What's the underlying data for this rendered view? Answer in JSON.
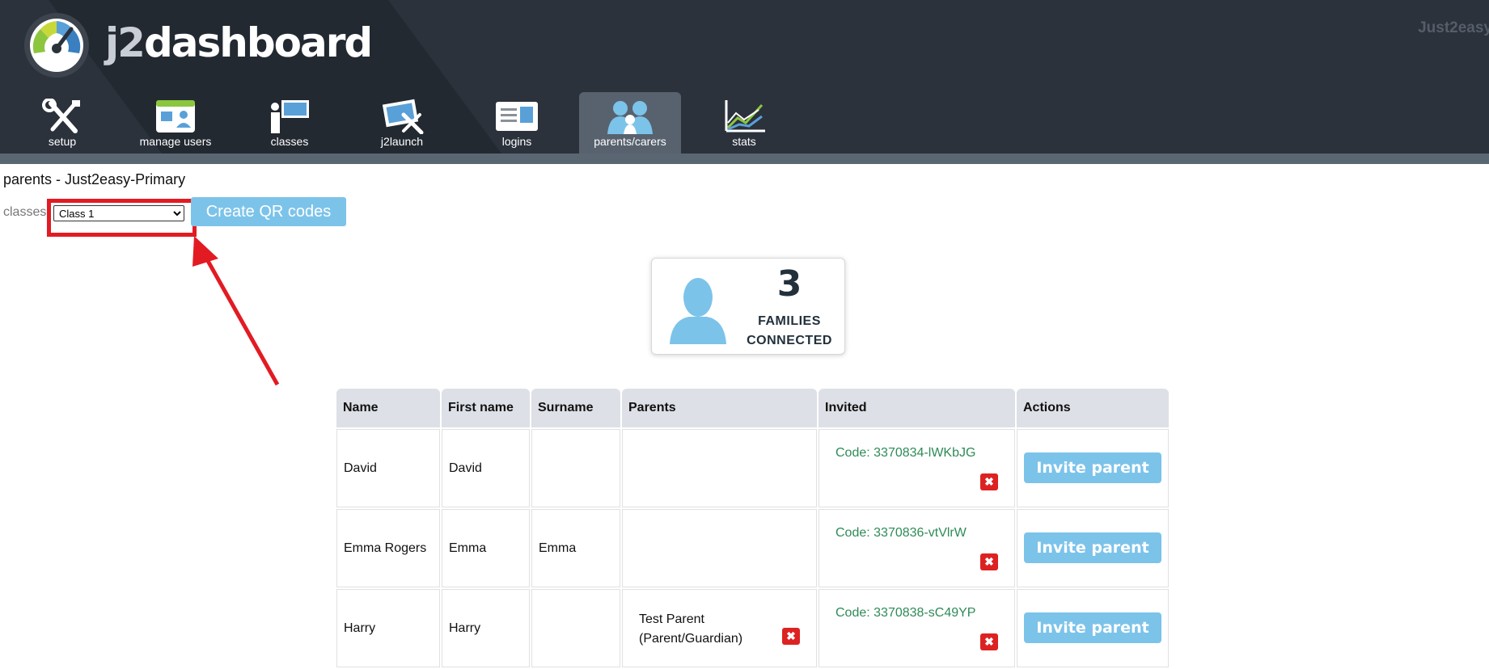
{
  "header": {
    "brand_prefix": "j2",
    "brand_suffix": "dashboard",
    "top_right": "Just2easy",
    "nav": [
      {
        "label": "setup",
        "icon": "tools-icon"
      },
      {
        "label": "manage users",
        "icon": "manage-users-icon"
      },
      {
        "label": "classes",
        "icon": "classes-icon"
      },
      {
        "label": "j2launch",
        "icon": "j2launch-icon"
      },
      {
        "label": "logins",
        "icon": "id-card-icon"
      },
      {
        "label": "parents/carers",
        "icon": "parents-icon",
        "active": true
      },
      {
        "label": "stats",
        "icon": "chart-icon"
      }
    ]
  },
  "page": {
    "title": "parents - Just2easy-Primary",
    "classes_label": "classes",
    "class_select": {
      "selected": "Class 1"
    },
    "qr_button": "Create QR codes"
  },
  "stat": {
    "number": "3",
    "label_line1": "FAMILIES",
    "label_line2": "CONNECTED"
  },
  "table": {
    "headers": [
      "Name",
      "First name",
      "Surname",
      "Parents",
      "Invited",
      "Actions"
    ],
    "rows": [
      {
        "name": "David",
        "first": "David",
        "surname": "",
        "parent_line1": "",
        "parent_line2": "",
        "code": "Code: 3370834-lWKbJG",
        "action": "Invite parent"
      },
      {
        "name": "Emma Rogers",
        "first": "Emma",
        "surname": "Emma",
        "parent_line1": "",
        "parent_line2": "",
        "code": "Code: 3370836-vtVlrW",
        "action": "Invite parent"
      },
      {
        "name": "Harry",
        "first": "Harry",
        "surname": "",
        "parent_line1": "Test Parent",
        "parent_line2": "(Parent/Guardian)",
        "code": "Code: 3370838-sC49YP",
        "action": "Invite parent"
      }
    ]
  },
  "colors": {
    "header_bg": "#2b323c",
    "accent_blue": "#7cc3ea",
    "delete_red": "#dd2222",
    "code_green": "#2e8b57",
    "annotation_red": "#e21b23"
  }
}
